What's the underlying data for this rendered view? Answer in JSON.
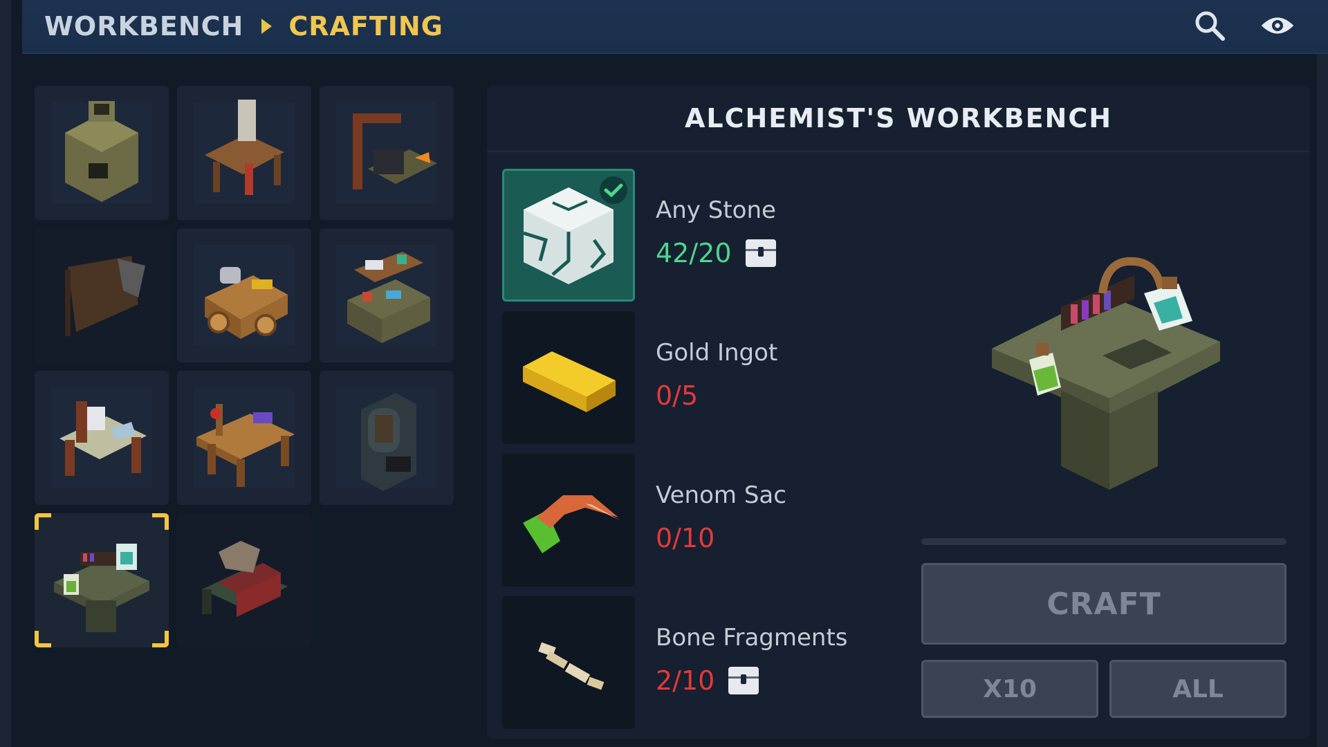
{
  "breadcrumb": {
    "root": "WORKBENCH",
    "current": "CRAFTING"
  },
  "header_icons": [
    "search-icon",
    "eye-icon"
  ],
  "workbenches": [
    {
      "id": "stone-furnace"
    },
    {
      "id": "tanning-bench"
    },
    {
      "id": "anvil-forge"
    },
    {
      "id": "hide-rack"
    },
    {
      "id": "cart-bench"
    },
    {
      "id": "cooking-bench"
    },
    {
      "id": "cloth-bench"
    },
    {
      "id": "carpentry-bench"
    },
    {
      "id": "iron-furnace"
    },
    {
      "id": "alchemists-workbench",
      "selected": true
    },
    {
      "id": "arcane-bench"
    }
  ],
  "detail": {
    "title": "ALCHEMIST'S WORKBENCH",
    "ingredients": [
      {
        "name": "Any Stone",
        "count": "42/20",
        "status": "ok",
        "icon": "stone-icon",
        "has_chest": true,
        "checked": true
      },
      {
        "name": "Gold Ingot",
        "count": "0/5",
        "status": "bad",
        "icon": "gold-ingot-icon",
        "has_chest": false
      },
      {
        "name": "Venom Sac",
        "count": "0/10",
        "status": "bad",
        "icon": "venom-sac-icon",
        "has_chest": false
      },
      {
        "name": "Bone Fragments",
        "count": "2/10",
        "status": "bad",
        "icon": "bone-fragments-icon",
        "has_chest": true
      }
    ],
    "craft_progress": 0,
    "buttons": {
      "craft": "CRAFT",
      "x10": "X10",
      "all": "ALL"
    }
  },
  "colors": {
    "accent": "#f1c64f",
    "ok": "#4fd58e",
    "bad": "#e4393b"
  }
}
